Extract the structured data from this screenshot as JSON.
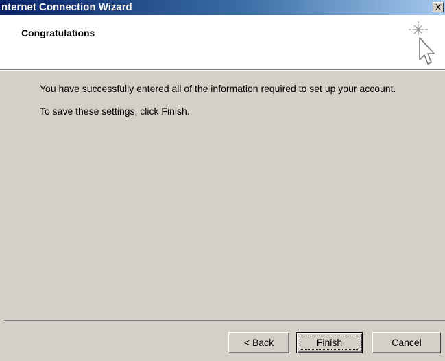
{
  "window": {
    "title": "nternet Connection Wizard",
    "close_label": "X"
  },
  "header": {
    "title": "Congratulations",
    "icon": "wizard-cursor-sparkle-icon"
  },
  "body": {
    "message_1": "You have successfully entered all of the information required to set up your account.",
    "message_2": "To save these settings, click Finish."
  },
  "buttons": {
    "back_arrow": "<",
    "back_label": "Back",
    "finish_label": "Finish",
    "cancel_label": "Cancel"
  },
  "colors": {
    "titlebar_start": "#0a246a",
    "titlebar_end": "#a6caf0",
    "dialog_face": "#d4d0c8",
    "header_bg": "#ffffff"
  }
}
